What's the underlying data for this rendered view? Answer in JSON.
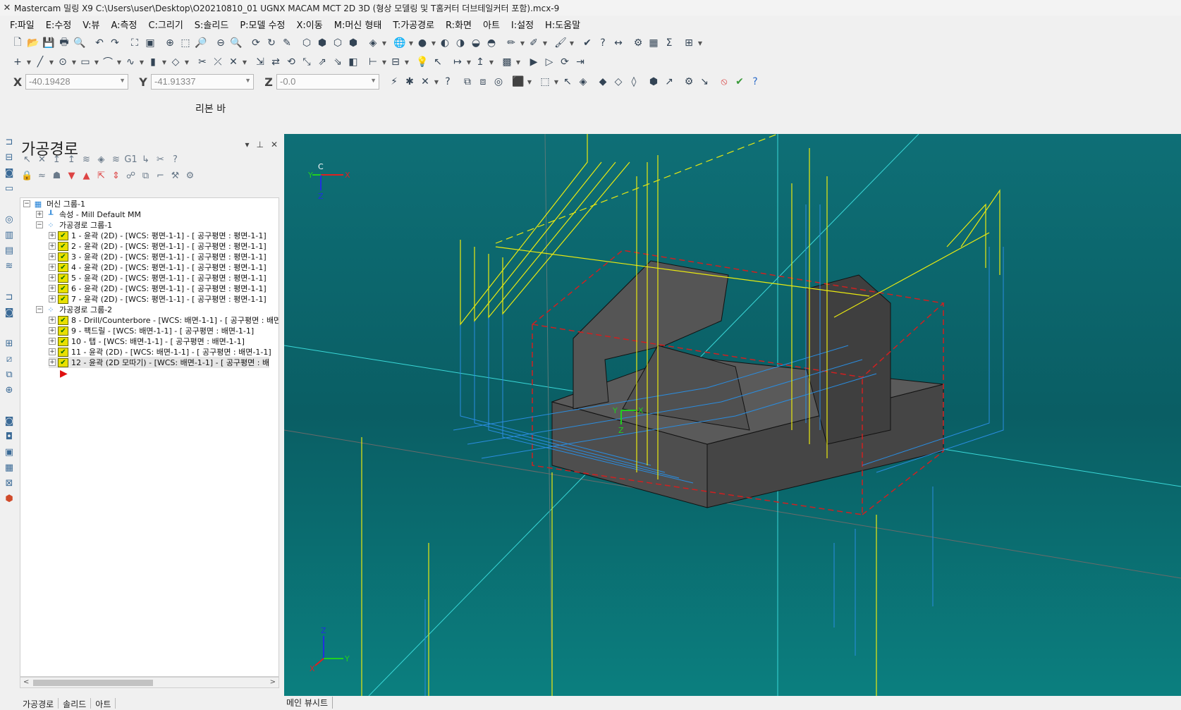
{
  "window": {
    "title": "Mastercam 밀링 X9  C:\\Users\\user\\Desktop\\O20210810_01 UGNX MACAM MCT 2D 3D (형상 모델링 및 T홈커터 더브테일커터 포함).mcx-9"
  },
  "menu": [
    "F:파일",
    "E:수정",
    "V:뷰",
    "A:측정",
    "C:그리기",
    "S:솔리드",
    "P:모델 수정",
    "X:이동",
    "M:머신 형태",
    "T:가공경로",
    "R:화면",
    "아트",
    "I:설정",
    "H:도움말"
  ],
  "coords": {
    "x_label": "X",
    "x_value": "-40.19428",
    "y_label": "Y",
    "y_value": "-41.91337",
    "z_label": "Z",
    "z_value": "-0.0"
  },
  "ribbon_label": "리본 바",
  "panel": {
    "title": "가공경로",
    "tree": [
      {
        "label": "머신 그룹-1",
        "level": 0,
        "type": "machine"
      },
      {
        "label": "속성 - Mill Default MM",
        "level": 1,
        "type": "props"
      },
      {
        "label": "가공경로 그룹-1",
        "level": 1,
        "type": "group"
      },
      {
        "label": "1 - 윤곽 (2D) - [WCS: 평면-1-1] - [ 공구평면 : 평면-1-1]",
        "level": 2,
        "type": "op"
      },
      {
        "label": "2 - 윤곽 (2D) - [WCS: 평면-1-1] - [ 공구평면 : 평면-1-1]",
        "level": 2,
        "type": "op"
      },
      {
        "label": "3 - 윤곽 (2D) - [WCS: 평면-1-1] - [ 공구평면 : 평면-1-1]",
        "level": 2,
        "type": "op"
      },
      {
        "label": "4 - 윤곽 (2D) - [WCS: 평면-1-1] - [ 공구평면 : 평면-1-1]",
        "level": 2,
        "type": "op"
      },
      {
        "label": "5 - 윤곽 (2D) - [WCS: 평면-1-1] - [ 공구평면 : 평면-1-1]",
        "level": 2,
        "type": "op"
      },
      {
        "label": "6 - 윤곽 (2D) - [WCS: 평면-1-1] - [ 공구평면 : 평면-1-1]",
        "level": 2,
        "type": "op"
      },
      {
        "label": "7 - 윤곽 (2D) - [WCS: 평면-1-1] - [ 공구평면 : 평면-1-1]",
        "level": 2,
        "type": "op"
      },
      {
        "label": "가공경로 그룹-2",
        "level": 1,
        "type": "group"
      },
      {
        "label": "8 - Drill/Counterbore - [WCS: 배면-1-1] - [ 공구평면 : 배면",
        "level": 2,
        "type": "op"
      },
      {
        "label": "9 - 팩드릴 - [WCS: 배면-1-1] - [ 공구평면 : 배면-1-1]",
        "level": 2,
        "type": "op"
      },
      {
        "label": "10 - 탭 - [WCS: 배면-1-1] - [ 공구평면 : 배면-1-1]",
        "level": 2,
        "type": "op"
      },
      {
        "label": "11 - 윤곽 (2D) - [WCS: 배면-1-1] - [ 공구평면 : 배면-1-1]",
        "level": 2,
        "type": "op"
      },
      {
        "label": "12 - 윤곽 (2D 모따기) - [WCS: 배면-1-1] - [ 공구평면 : 배",
        "level": 2,
        "type": "op",
        "selected": true
      }
    ]
  },
  "bottom_tabs": [
    "가공경로",
    "솔리드",
    "아트"
  ],
  "status": {
    "viewsheet": "메인 뷰시트"
  },
  "viewport": {
    "gnomon_top": {
      "c": "C",
      "x": "X",
      "y": "Y",
      "z": "Z"
    },
    "gnomon_mid": {
      "x": "X",
      "y": "Y",
      "z": "Z"
    },
    "gnomon_bottom": {
      "x": "X",
      "y": "Y",
      "z": "Z"
    }
  },
  "colors": {
    "viewport_bg": "#0b6a70",
    "solid_top": "#5a5a5a",
    "solid_side": "#4a4a4a",
    "toolpath_rapid": "#f0f000",
    "toolpath_feed": "#2a8de0",
    "stock_edge": "#d02020",
    "axis_cyan": "#30e0e0"
  }
}
